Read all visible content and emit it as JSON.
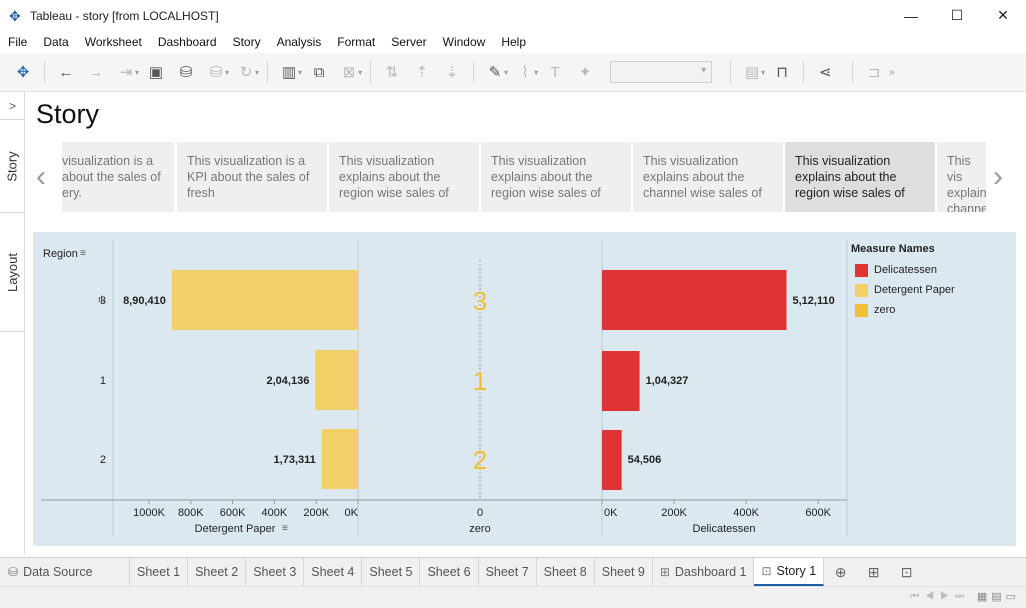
{
  "window": {
    "title": "Tableau - story [from LOCALHOST]",
    "minimize": "—",
    "maximize": "☐",
    "close": "✕"
  },
  "menu": [
    "File",
    "Data",
    "Worksheet",
    "Dashboard",
    "Story",
    "Analysis",
    "Format",
    "Server",
    "Window",
    "Help"
  ],
  "side_panel": {
    "toggle": ">",
    "tabs": [
      "Story",
      "Layout"
    ]
  },
  "story": {
    "title": "Story",
    "prev_arrow": "‹",
    "next_arrow": "›",
    "points": [
      {
        "text": "visualization is a about the sales of ery.",
        "active": false
      },
      {
        "text": "This visualization is a KPI about the sales of fresh",
        "active": false
      },
      {
        "text": "This visualization explains about the region wise sales of",
        "active": false
      },
      {
        "text": "This visualization explains about the region wise sales of",
        "active": false
      },
      {
        "text": "This visualization explains about the channel wise sales of",
        "active": false
      },
      {
        "text": "This visualization explains about the region wise sales of",
        "active": true
      },
      {
        "text": "This vis explain channe",
        "active": false
      }
    ]
  },
  "chart_data": {
    "type": "bar",
    "row_header": "Region",
    "categories": [
      "3",
      "1",
      "2"
    ],
    "panes": [
      {
        "name": "Detergent Paper",
        "axis_ticks": [
          "1000K",
          "800K",
          "600K",
          "400K",
          "200K",
          "0K"
        ],
        "reversed": true,
        "xlim": [
          0,
          1000000
        ]
      },
      {
        "name": "zero",
        "axis_ticks": [
          "0"
        ],
        "xlim": [
          0,
          0
        ]
      },
      {
        "name": "Delicatessen",
        "axis_ticks": [
          "0K",
          "200K",
          "400K",
          "600K"
        ],
        "xlim": [
          0,
          680000
        ]
      }
    ],
    "series": [
      {
        "name": "Detergent Paper",
        "color": "#f2cf67",
        "values": [
          890410,
          204136,
          173311
        ],
        "labels": [
          "8,90,410",
          "2,04,136",
          "1,73,311"
        ]
      },
      {
        "name": "zero",
        "color": "#f0bf33",
        "values": [
          0,
          0,
          0
        ],
        "labels": [
          "3",
          "1",
          "2"
        ]
      },
      {
        "name": "Delicatessen",
        "color": "#e03434",
        "values": [
          512110,
          104327,
          54506
        ],
        "labels": [
          "5,12,110",
          "1,04,327",
          "54,506"
        ]
      }
    ],
    "legend": {
      "title": "Measure Names",
      "position": "right"
    }
  },
  "tabs": {
    "data_source": "Data Source",
    "sheets": [
      "Sheet 1",
      "Sheet 2",
      "Sheet 3",
      "Sheet 4",
      "Sheet 5",
      "Sheet 6",
      "Sheet 7",
      "Sheet 8",
      "Sheet 9"
    ],
    "dashboard": "Dashboard 1",
    "story": "Story 1"
  },
  "icons": {
    "app": "tableau-logo-icon",
    "toolbar": [
      "tableau-home-icon",
      "undo-icon",
      "redo-icon",
      "replay-icon",
      "save-icon",
      "new-datasource-icon",
      "datasource-icon",
      "refresh-icon",
      "new-worksheet-icon",
      "duplicate-icon",
      "clear-icon",
      "swap-icon",
      "sort-ascending-icon",
      "sort-descending-icon",
      "highlight-icon",
      "attach-icon",
      "label-icon",
      "pin-icon",
      "show-me-icon",
      "presentation-icon",
      "share-icon",
      "pane-icon"
    ]
  }
}
